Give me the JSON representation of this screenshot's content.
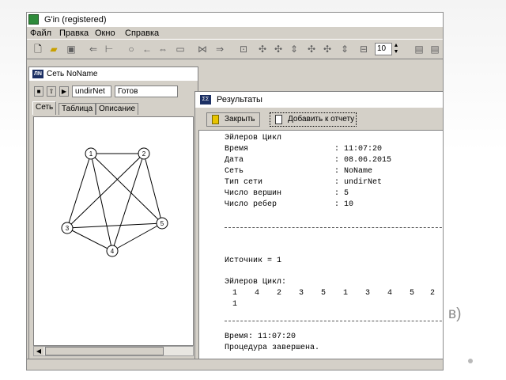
{
  "app": {
    "title": "G'in (registered)",
    "menu": [
      "Файл",
      "Правка",
      "Окно",
      "Справка"
    ],
    "zoom_value": "10"
  },
  "network_window": {
    "title": "Сеть NoName",
    "type_field": "undirNet",
    "status_field": "Готов",
    "tabs": [
      "Сеть",
      "Таблица",
      "Описание"
    ],
    "active_tab": "Сеть",
    "graph": {
      "vertices": [
        "1",
        "2",
        "3",
        "4",
        "5"
      ],
      "edges": [
        [
          "1",
          "2"
        ],
        [
          "1",
          "3"
        ],
        [
          "1",
          "4"
        ],
        [
          "1",
          "5"
        ],
        [
          "2",
          "3"
        ],
        [
          "2",
          "4"
        ],
        [
          "2",
          "5"
        ],
        [
          "3",
          "4"
        ],
        [
          "3",
          "5"
        ],
        [
          "4",
          "5"
        ]
      ]
    }
  },
  "results_window": {
    "title": "Результаты",
    "close_button": "Закрыть",
    "add_button": "Добавить к отчету",
    "report": {
      "heading": "Эйлеров Цикл",
      "fields": [
        {
          "label": "Время",
          "value": ": 11:07:20"
        },
        {
          "label": "Дата",
          "value": ": 08.06.2015"
        },
        {
          "label": "Сеть",
          "value": ": NoName"
        },
        {
          "label": "Тип сети",
          "value": ": undirNet"
        },
        {
          "label": "Число вершин",
          "value": ": 5"
        },
        {
          "label": "Число ребер",
          "value": ": 10"
        }
      ],
      "source_line": "Источник = 1",
      "cycle_heading": "Эйлеров Цикл:",
      "cycle_sequence": [
        "1",
        "4",
        "2",
        "3",
        "5",
        "1",
        "3",
        "4",
        "5",
        "2"
      ],
      "cycle_sequence_end": "1",
      "time_line": "Время: 11:07:20",
      "done_line": "Процедура завершена."
    }
  },
  "slide": {
    "partial_text": "в)"
  },
  "colors": {
    "window_face": "#d4d0c8",
    "canvas": "#ffffff",
    "icon_navy": "#1b2f63",
    "app_icon_green": "#2e8b3a"
  }
}
